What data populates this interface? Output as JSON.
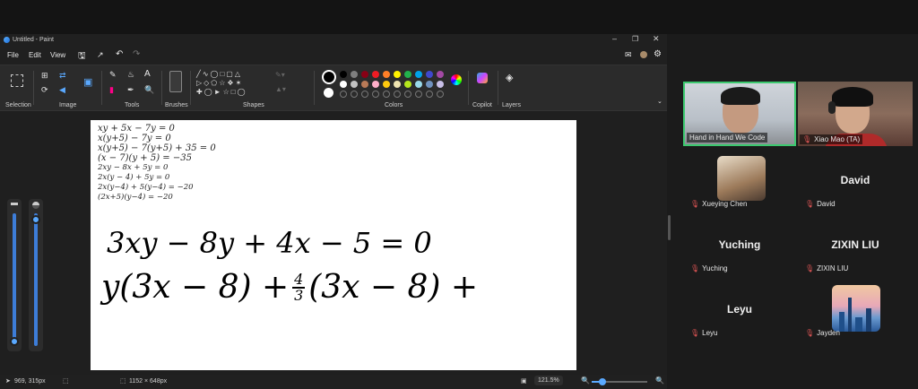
{
  "paint": {
    "title": "Untitled - Paint",
    "menu": [
      "File",
      "Edit",
      "View"
    ],
    "groups": {
      "selection": "Selection",
      "image": "Image",
      "tools": "Tools",
      "brushes": "Brushes",
      "shapes": "Shapes",
      "colors": "Colors",
      "copilot": "Copilot",
      "layers": "Layers"
    },
    "palette_row1": [
      "#000000",
      "#7f7f7f",
      "#880015",
      "#ed1c24",
      "#ff7f27",
      "#fff200",
      "#22b14c",
      "#00a2e8",
      "#3f48cc",
      "#a349a4"
    ],
    "palette_row2": [
      "#ffffff",
      "#c3c3c3",
      "#b97a57",
      "#ffaec9",
      "#ffc90e",
      "#efe4b0",
      "#b5e61d",
      "#99d9ea",
      "#7092be",
      "#c8bfe7"
    ],
    "status": {
      "cursor": "969, 315px",
      "size": "1152 × 648px",
      "zoom": "121.5%"
    },
    "canvas_text": {
      "line1": "xy + 5x − 7y = 0",
      "line2": "x(y+5) − 7y = 0",
      "line3": "x(y+5) − 7(y+5) + 35 = 0",
      "line4": "(x − 7)(y + 5) = −35",
      "line5": "2xy − 8x + 5y = 0",
      "line6": "2x(y − 4) + 5y = 0",
      "line7": "2x(y−4) + 5(y−4) = −20",
      "line8": "(2x+5)(y−4) = −20",
      "big1": "3xy − 8y + 4x − 5 = 0",
      "big2_a": "y(3x − 8) + ",
      "big2_num": "4",
      "big2_den": "3",
      "big2_b": "(3x − 8) +"
    }
  },
  "meeting": {
    "participants": [
      {
        "name": "Hand in Hand We Code",
        "muted": false,
        "active": true
      },
      {
        "name": "Xiao Mao (TA)",
        "muted": true
      },
      {
        "name": "Xueying Chen",
        "muted": true
      },
      {
        "name": "David",
        "muted": true,
        "display": "David"
      },
      {
        "name": "Yuching",
        "muted": true,
        "display": "Yuching"
      },
      {
        "name": "ZIXIN LIU",
        "muted": true,
        "display": "ZIXIN LIU"
      },
      {
        "name": "Leyu",
        "muted": true,
        "display": "Leyu"
      },
      {
        "name": "Jayden",
        "muted": true
      }
    ]
  }
}
